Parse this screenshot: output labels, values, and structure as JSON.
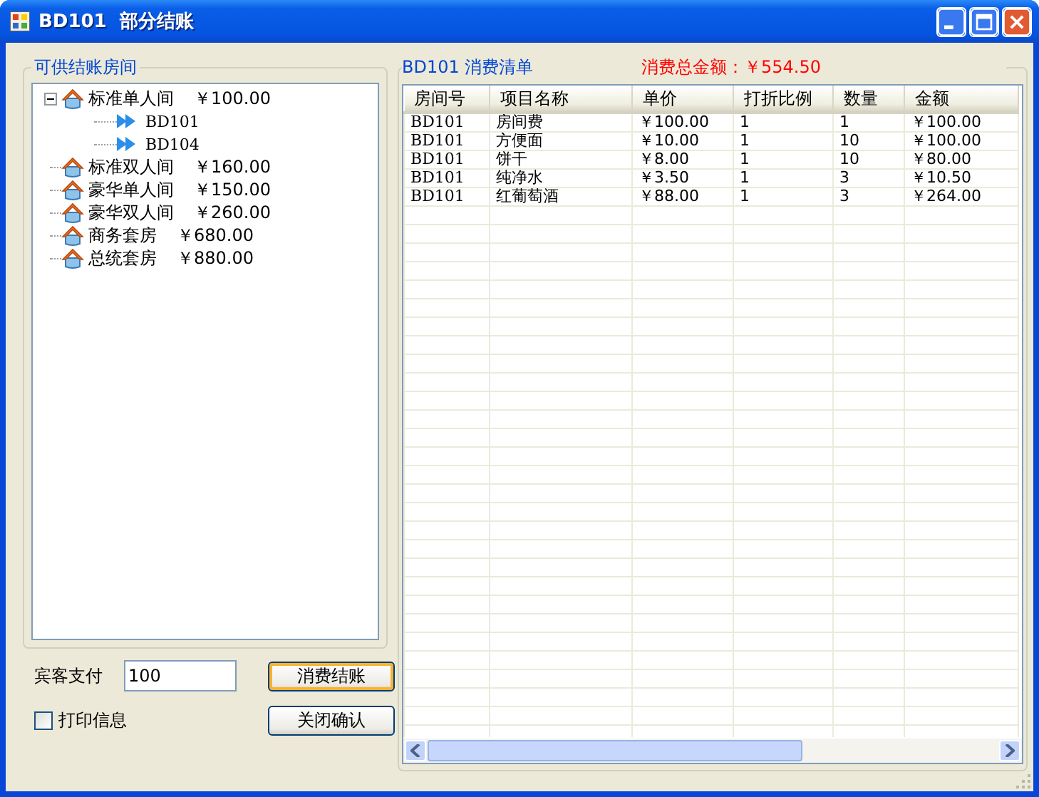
{
  "window": {
    "title": "BD101  部分结账"
  },
  "rooms_panel": {
    "title": "可供结账房间",
    "rooms": [
      {
        "name": "标准单人间",
        "price": "￥100.00",
        "expanded": true,
        "children": [
          {
            "name": "BD101"
          },
          {
            "name": "BD104"
          }
        ]
      },
      {
        "name": "标准双人间",
        "price": "￥160.00"
      },
      {
        "name": "豪华单人间",
        "price": "￥150.00"
      },
      {
        "name": "豪华双人间",
        "price": "￥260.00"
      },
      {
        "name": "商务套房",
        "price": "￥680.00"
      },
      {
        "name": "总统套房",
        "price": "￥880.00"
      }
    ]
  },
  "payment": {
    "label": "宾客支付",
    "value": "100"
  },
  "print_info": {
    "label": "打印信息",
    "checked": false
  },
  "buttons": [
    {
      "label": "消费结账",
      "focused": true
    },
    {
      "label": "关闭确认",
      "focused": false
    }
  ],
  "bill": {
    "title": "BD101 消费清单",
    "total": "消费总金额：￥554.50",
    "columns": [
      "房间号",
      "项目名称",
      "单价",
      "打折比例",
      "数量",
      "金额"
    ],
    "rows": [
      [
        "BD101",
        "房间费",
        "￥100.00",
        "1",
        "1",
        "￥100.00"
      ],
      [
        "BD101",
        "方便面",
        "￥10.00",
        "1",
        "10",
        "￥100.00"
      ],
      [
        "BD101",
        "饼干",
        "￥8.00",
        "1",
        "10",
        "￥80.00"
      ],
      [
        "BD101",
        "纯净水",
        "￥3.50",
        "1",
        "3",
        "￥10.50"
      ],
      [
        "BD101",
        "红葡萄酒",
        "￥88.00",
        "1",
        "3",
        "￥264.00"
      ]
    ]
  }
}
